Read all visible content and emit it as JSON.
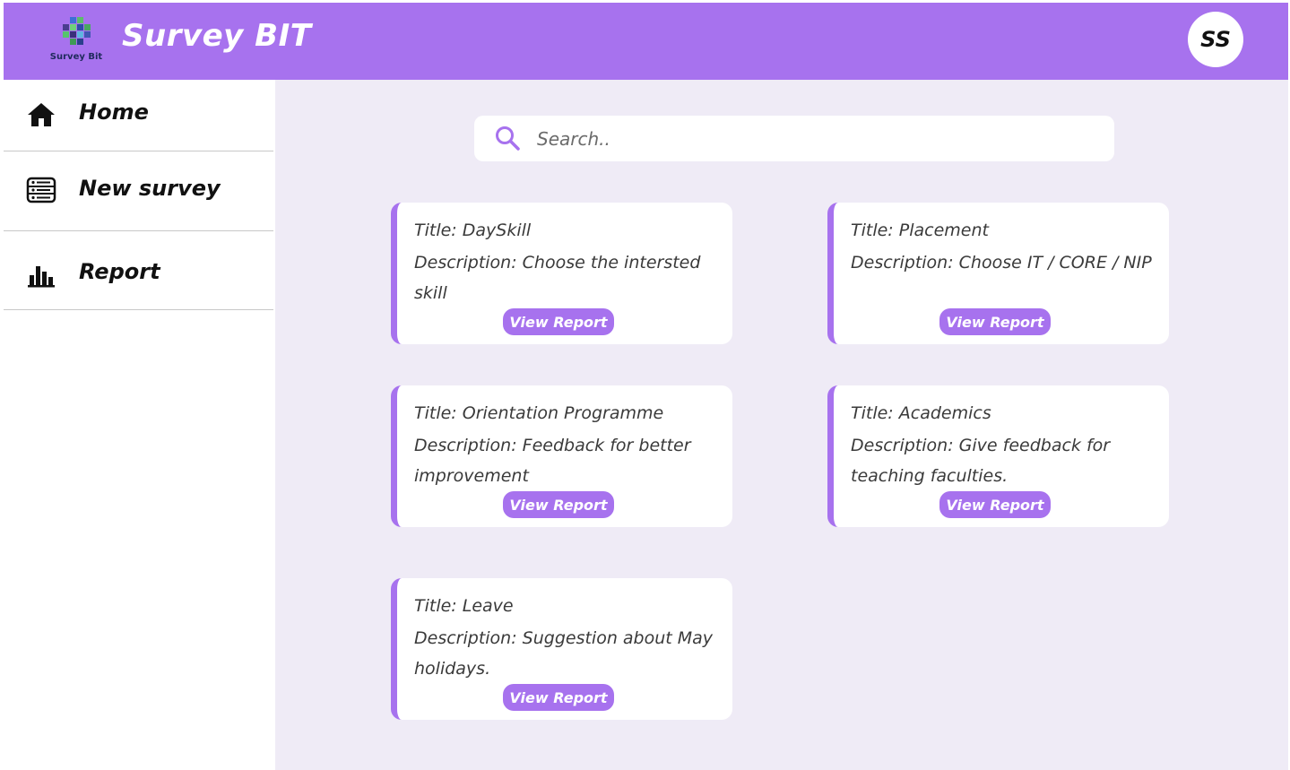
{
  "header": {
    "logo_text": "Survey Bit",
    "app_title": "Survey BIT",
    "avatar_initials": "SS",
    "accent_color": "#a772ee"
  },
  "sidebar": {
    "items": [
      {
        "label": "Home",
        "icon": "home-icon"
      },
      {
        "label": "New survey",
        "icon": "form-list-icon"
      },
      {
        "label": "Report",
        "icon": "bar-chart-icon"
      }
    ]
  },
  "search": {
    "placeholder": "Search..",
    "value": ""
  },
  "surveys": [
    {
      "title": "Title: DaySkill",
      "description": "Description: Choose the intersted skill",
      "button_label": "View Report"
    },
    {
      "title": "Title: Placement",
      "description": "Description: Choose IT / CORE / NIP",
      "button_label": "View Report"
    },
    {
      "title": "Title: Orientation Programme",
      "description": "Description: Feedback for better improvement",
      "button_label": "View Report"
    },
    {
      "title": "Title: Academics",
      "description": "Description: Give feedback for teaching faculties.",
      "button_label": "View Report"
    },
    {
      "title": "Title: Leave",
      "description": "Description: Suggestion about May holidays.",
      "button_label": "View Report"
    }
  ]
}
